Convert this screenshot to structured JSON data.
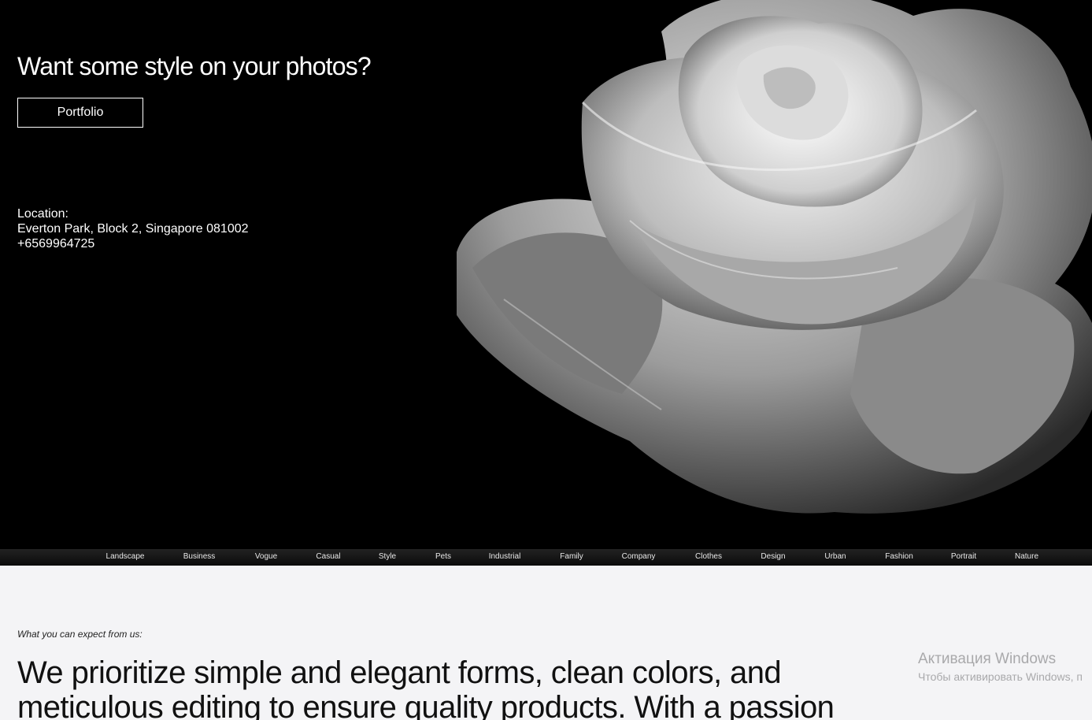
{
  "hero": {
    "title": "Want some style on your photos?",
    "portfolio_label": "Portfolio",
    "location_label": "Location:",
    "address": "Everton Park, Block 2, Singapore 081002",
    "phone": "+6569964725"
  },
  "categories": [
    "Landscape",
    "Business",
    "Vogue",
    "Casual",
    "Style",
    "Pets",
    "Industrial",
    "Family",
    "Company",
    "Clothes",
    "Design",
    "Urban",
    "Fashion",
    "Portrait",
    "Nature"
  ],
  "about": {
    "tagline": "What you can expect from us:",
    "statement": "We prioritize simple and elegant forms, clean colors, and meticulous editing to ensure quality products. With a passion"
  },
  "watermark": {
    "title": "Активация Windows",
    "subtitle": "Чтобы активировать Windows, п"
  }
}
